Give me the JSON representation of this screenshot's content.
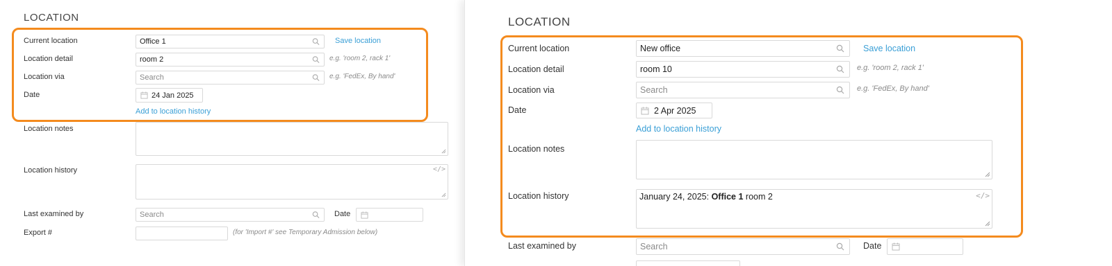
{
  "left": {
    "section_title": "LOCATION",
    "current_location": {
      "label": "Current location",
      "value": "Office 1"
    },
    "save_location": "Save location",
    "location_detail": {
      "label": "Location detail",
      "value": "room 2",
      "hint": "e.g. 'room 2, rack 1'"
    },
    "location_via": {
      "label": "Location via",
      "placeholder": "Search",
      "hint": "e.g. 'FedEx, By hand'"
    },
    "date": {
      "label": "Date",
      "value": "24 Jan 2025"
    },
    "add_history": "Add to location history",
    "location_notes": {
      "label": "Location notes"
    },
    "location_history": {
      "label": "Location history"
    },
    "last_examined": {
      "label": "Last examined by",
      "placeholder": "Search",
      "date_label": "Date"
    },
    "export": {
      "label": "Export #",
      "hint": "(for 'Import #' see Temporary Admission below)"
    }
  },
  "right": {
    "section_title": "LOCATION",
    "current_location": {
      "label": "Current location",
      "value": "New office"
    },
    "save_location": "Save location",
    "location_detail": {
      "label": "Location detail",
      "value": "room 10",
      "hint": "e.g. 'room 2, rack 1'"
    },
    "location_via": {
      "label": "Location via",
      "placeholder": "Search",
      "hint": "e.g. 'FedEx, By hand'"
    },
    "date": {
      "label": "Date",
      "value": "2 Apr 2025"
    },
    "add_history": "Add to location history",
    "location_notes": {
      "label": "Location notes"
    },
    "location_history": {
      "label": "Location history",
      "entry_date": "January 24, 2025:",
      "entry_location": "Office 1",
      "entry_detail": "room 2"
    },
    "last_examined": {
      "label": "Last examined by",
      "placeholder": "Search",
      "date_label": "Date"
    }
  },
  "colors": {
    "highlight": "#f48b1e",
    "link": "#3a9fd6",
    "hint": "#8a8a8a",
    "border": "#d9d9d9"
  },
  "icons": [
    "search-icon",
    "calendar-icon",
    "resize-handle-icon",
    "code-icon"
  ]
}
